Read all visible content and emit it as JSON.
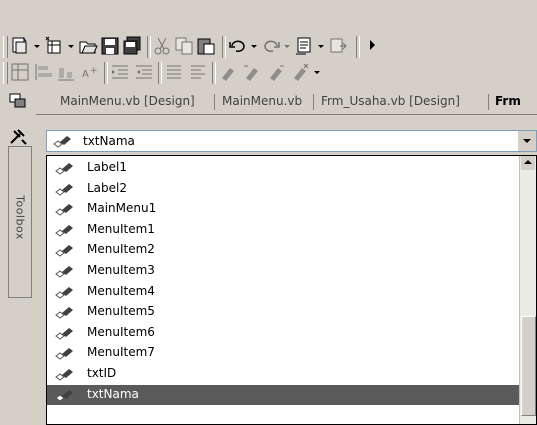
{
  "tabs": [
    {
      "label": "MainMenu.vb [Design]"
    },
    {
      "label": "MainMenu.vb"
    },
    {
      "label": "Frm_Usaha.vb [Design]"
    },
    {
      "label": "Frm"
    }
  ],
  "dock": {
    "toolbox_label": "Toolbox"
  },
  "object_combo": {
    "selected": "txtNama"
  },
  "object_list": {
    "items": [
      {
        "label": "Label1"
      },
      {
        "label": "Label2"
      },
      {
        "label": "MainMenu1"
      },
      {
        "label": "MenuItem1"
      },
      {
        "label": "MenuItem2"
      },
      {
        "label": "MenuItem3"
      },
      {
        "label": "MenuItem4"
      },
      {
        "label": "MenuItem5"
      },
      {
        "label": "MenuItem6"
      },
      {
        "label": "MenuItem7"
      },
      {
        "label": "txtID"
      },
      {
        "label": "txtNama",
        "selected": true
      }
    ]
  },
  "colors": {
    "selection": "#5a5a5a",
    "chrome": "#d4d0c8"
  }
}
